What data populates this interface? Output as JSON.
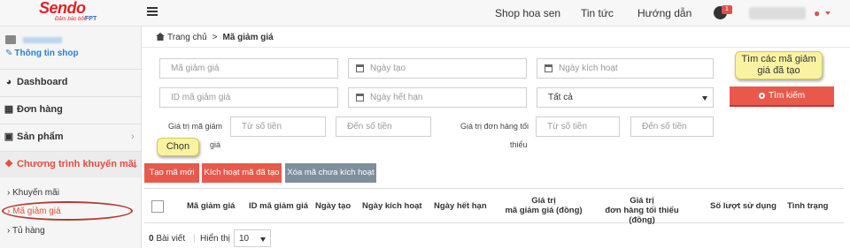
{
  "brand": {
    "name": "Sendo",
    "tagline": "Đảm bảo bởi",
    "partner": "FPT",
    "accent": "#e41f26"
  },
  "header": {
    "nav": [
      "Shop hoa sen",
      "Tin tức",
      "Hướng dẫn"
    ],
    "notification_count": "1"
  },
  "sidebar": {
    "shop_info_label": "Thông tin shop",
    "items": [
      {
        "label": "Dashboard",
        "icon": "dashboard-icon"
      },
      {
        "label": "Đơn hàng",
        "icon": "table-icon"
      },
      {
        "label": "Sản phẩm",
        "icon": "box-icon"
      },
      {
        "label": "Chương trình khuyến mãi",
        "icon": "tag-icon"
      }
    ],
    "subitems": [
      {
        "label": "Khuyến mãi"
      },
      {
        "label": "Mã giảm giá"
      },
      {
        "label": "Tủ hàng"
      }
    ]
  },
  "breadcrumb": {
    "home": "Trang chủ",
    "current": "Mã giảm giá"
  },
  "filters": {
    "code_placeholder": "Mã giảm giá",
    "id_placeholder": "ID mã giảm giá",
    "created_placeholder": "Ngày tạo",
    "expire_placeholder": "Ngày hết hạn",
    "activate_placeholder": "Ngày kích hoạt",
    "status_value": "Tất cả",
    "value_label_1": "Giá trị mã giảm",
    "value_label_2": "giá",
    "min_label_1": "Giá trị đơn hàng tối",
    "min_label_2": "thiểu",
    "from_placeholder": "Từ số tiền",
    "to_placeholder": "Đến số tiền",
    "search_button": "Tìm kiếm"
  },
  "actions": {
    "create": "Tạo mã mới",
    "activate": "Kích hoạt mã đã tạo",
    "delete": "Xóa mã chưa kích hoạt"
  },
  "tooltips": {
    "search": "Tìm các mã giảm giá đã tạo",
    "create": "Chọn"
  },
  "table": {
    "columns": [
      "Mã giảm giá",
      "ID mã giảm giá",
      "Ngày tạo",
      "Ngày kích hoạt",
      "Ngày hết hạn",
      "Giá trị\nmã giảm giá (đồng)",
      "Giá trị\nđơn hàng tối thiểu (đồng)",
      "Số lượt sử dụng",
      "Tình trạng"
    ]
  },
  "footer": {
    "count": "0",
    "count_label": "Bài viết",
    "show_label": "Hiển thị",
    "page_size": "10"
  }
}
